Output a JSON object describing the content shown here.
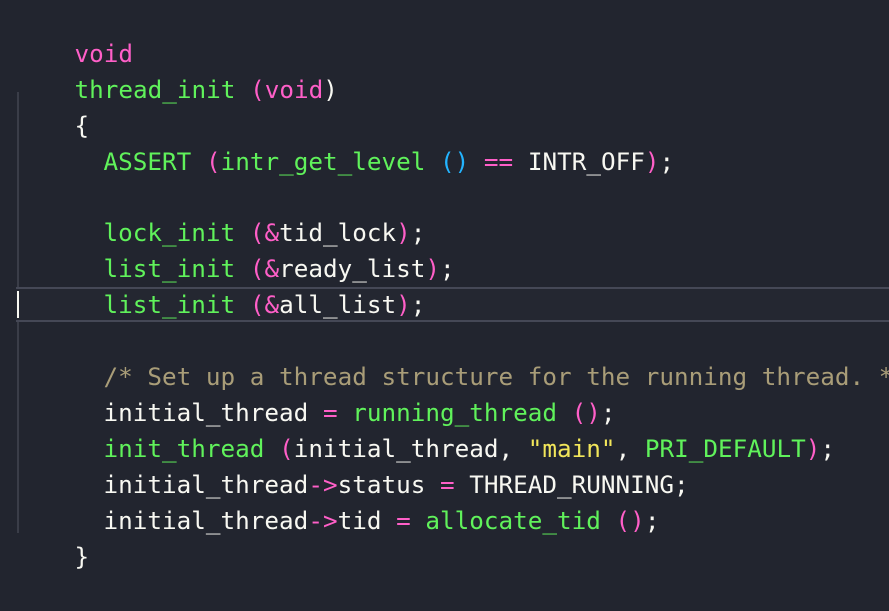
{
  "code": {
    "line1": {
      "keyword": "void"
    },
    "line2": {
      "function": "thread_init",
      "space": " ",
      "open": "(",
      "param": "void",
      "close": ")"
    },
    "line3": {
      "brace": "{"
    },
    "line4": {
      "function": "ASSERT",
      "space": " ",
      "open": "(",
      "inner": "intr_get_level",
      "space2": " ",
      "call": "()",
      "op": " ==",
      "space3": " ",
      "arg": "INTR_OFF",
      "close": ")",
      "semi": ";"
    },
    "line5": {
      "function": "lock_init",
      "space": " ",
      "open": "(",
      "amp": "&",
      "arg": "tid_lock",
      "close": ")",
      "semi": ";"
    },
    "line6": {
      "function": "list_init",
      "space": " ",
      "open": "(",
      "amp": "&",
      "arg": "ready_list",
      "close": ")",
      "semi": ";"
    },
    "line7": {
      "function": "list_init",
      "space": " ",
      "open": "(",
      "amp": "&",
      "arg": "all_list",
      "close": ")",
      "semi": ";"
    },
    "line8": {
      "comment": "/* Set up a thread structure for the running thread. */"
    },
    "line9": {
      "var": "initial_thread",
      "op": " = ",
      "function": "running_thread",
      "space": " ",
      "call": "()",
      "semi": ";"
    },
    "line10": {
      "function": "init_thread",
      "space": " ",
      "open": "(",
      "arg1": "initial_thread,",
      "space2": " ",
      "string": "\"main\"",
      "comma": ",",
      "space3": " ",
      "arg3": "PRI_DEFAULT",
      "close": ")",
      "semi": ";"
    },
    "line11": {
      "var": "initial_thread",
      "arrow": "->",
      "field": "status",
      "op": " = ",
      "value": "THREAD_RUNNING",
      "semi": ";"
    },
    "line12": {
      "var": "initial_thread",
      "arrow": "->",
      "field": "tid",
      "op": " = ",
      "function": "allocate_tid",
      "space": " ",
      "call": "()",
      "semi": ";"
    },
    "line13": {
      "brace": "}"
    }
  },
  "colors": {
    "background": "#22252f",
    "keyword": "#ff5fc8",
    "function": "#60f25b",
    "call_parens": "#23b4ff",
    "text": "#f8f8f2",
    "string": "#f2e65a",
    "comment": "#a99d78"
  }
}
